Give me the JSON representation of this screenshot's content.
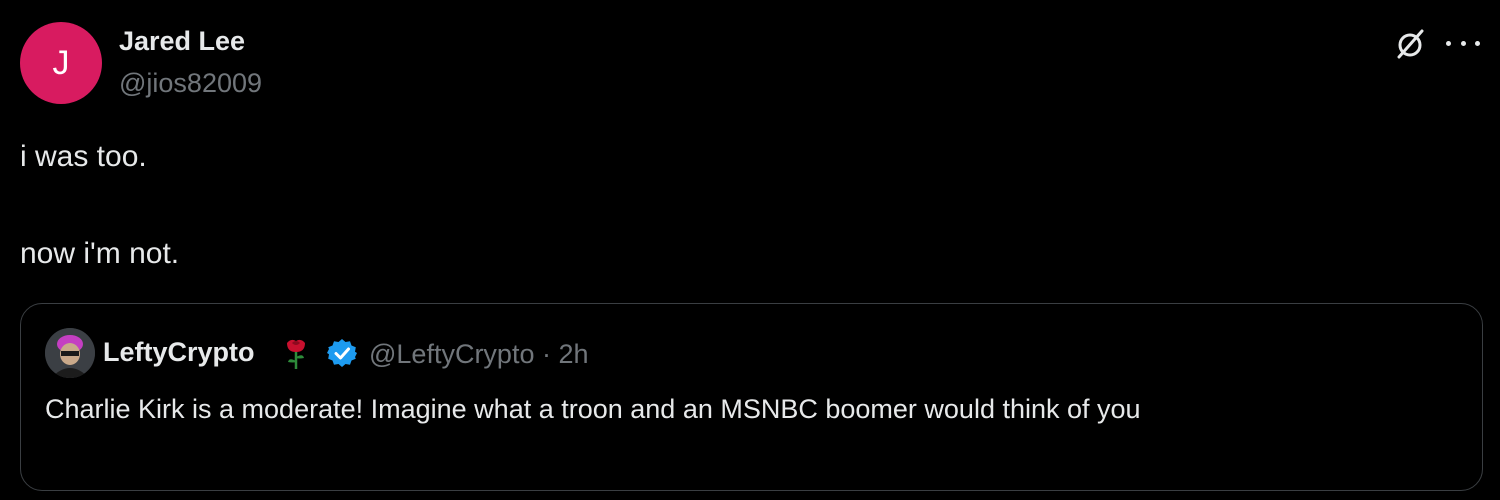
{
  "author": {
    "display_name": "Jared Lee",
    "handle": "@jios82009",
    "avatar_letter": "J",
    "avatar_color": "#d81b60"
  },
  "header_icons": {
    "grok": "grok-slash-circle-icon",
    "more": "more-dots-icon"
  },
  "post": {
    "line1": "i was too.",
    "line2": "now i'm not."
  },
  "quoted_post": {
    "display_name": "LeftyCrypto",
    "handle_time": "@LeftyCrypto · 2h",
    "text": "Charlie Kirk is a moderate! Imagine what a troon and an MSNBC boomer would think of you",
    "emoji": "rose-icon",
    "verified_color": "#1d9bf0"
  },
  "colors": {
    "background": "#000000",
    "text_primary": "#e7e9ea",
    "text_secondary": "#71767b",
    "border": "#3a3e42"
  }
}
